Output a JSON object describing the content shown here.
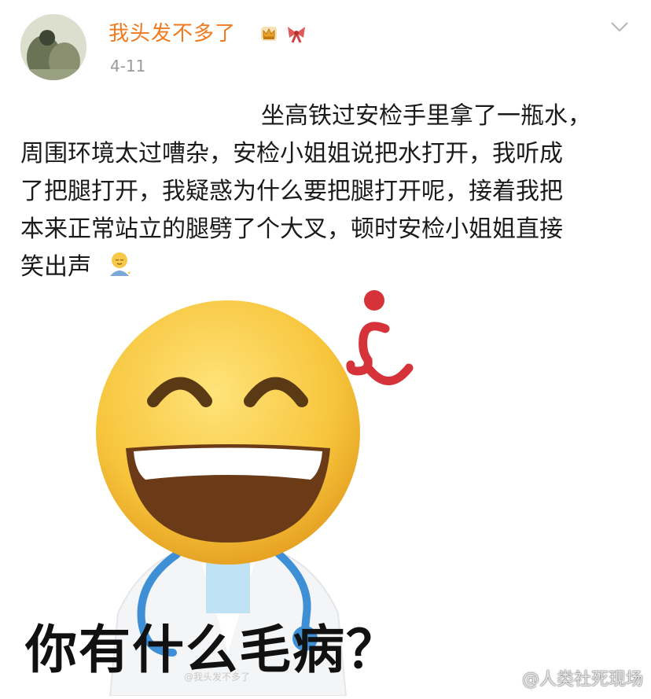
{
  "post": {
    "username": "我头发不多了",
    "date": "4-11",
    "text_lines": [
      "坐高铁过安检手里拿了一瓶水，",
      "周围环境太过嘈杂，安检小姐姐说把水打开，我听成",
      "了把腿打开，我疑惑为什么要把腿打开呢，接着我把",
      "本来正常站立的腿劈了个大叉，顿时安检小姐姐直接",
      "笑出声"
    ]
  },
  "meme": {
    "caption": "你有什么毛病？",
    "small_watermark": "@我头发不多了",
    "watermark": "@人类社死现场"
  },
  "icons": {
    "crown": "crown-icon",
    "bow": "bow-icon",
    "chevron": "chevron-down-icon",
    "emoji": "tired-emoji-icon",
    "weibo": "weibo-logo-icon"
  },
  "colors": {
    "username": "#f07a1f",
    "date": "#9a9a9a",
    "question_mark": "#d6323a",
    "emoji_face": "#f7c53c"
  }
}
